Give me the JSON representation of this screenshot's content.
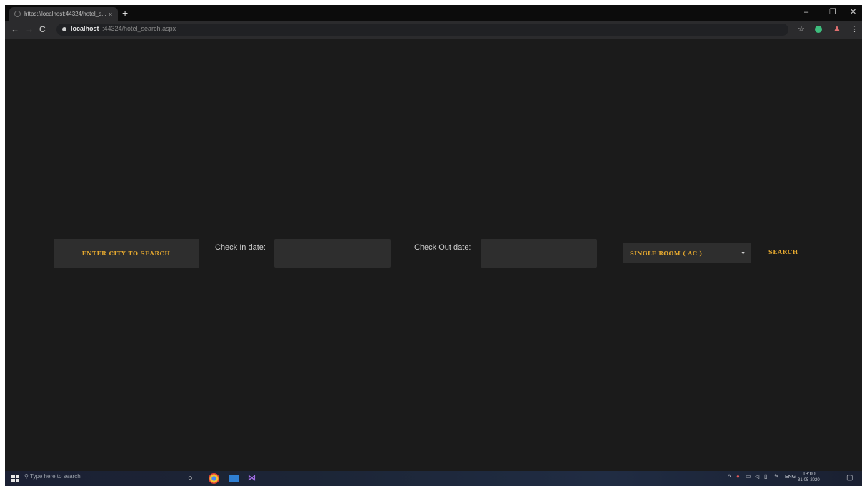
{
  "browser": {
    "tab_title": "https://localhost:44324/hotel_s...",
    "tab_close": "×",
    "new_tab": "+",
    "minimize": "–",
    "maximize": "❐",
    "close": "✕",
    "back": "←",
    "forward": "→",
    "reload": "C",
    "url_host": "localhost",
    "url_path": ":44324/hotel_search.aspx",
    "icons": [
      "back-icon",
      "forward-icon",
      "reload-icon",
      "lock-icon",
      "star-icon",
      "extension-icon",
      "account-icon",
      "menu-icon"
    ]
  },
  "form": {
    "city_button_label": "ENTER CITY TO SEARCH",
    "checkin_label": "Check In date:",
    "checkin_value": "",
    "checkout_label": "Check Out date:",
    "checkout_value": "",
    "room_type_selected": "SINGLE ROOM ( AC )",
    "search_label": "SEARCH"
  },
  "taskbar": {
    "search_placeholder": "Type here to search",
    "language": "ENG",
    "time": "13:00",
    "date": "31-05-2020"
  },
  "colors": {
    "accent": "#e3a72f",
    "page_background": "#1b1b1b",
    "control_background": "#2e2e2e"
  }
}
